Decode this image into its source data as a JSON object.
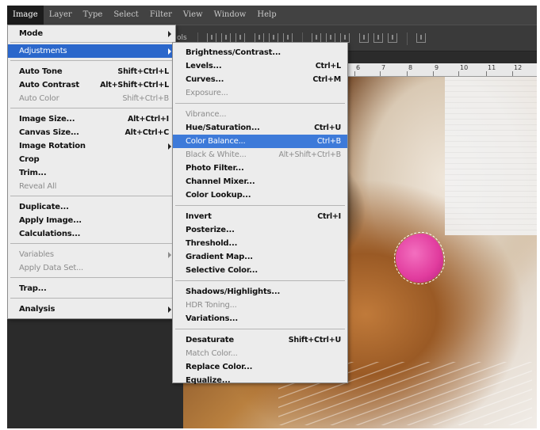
{
  "menubar": {
    "items": [
      "Image",
      "Layer",
      "Type",
      "Select",
      "Filter",
      "View",
      "Window",
      "Help"
    ]
  },
  "options_bar": {
    "label": "ols"
  },
  "ruler": {
    "marks": [
      "6",
      "7",
      "8",
      "9",
      "10",
      "11",
      "12"
    ]
  },
  "image_menu": {
    "items": [
      {
        "label": "Mode",
        "shortcut": "",
        "submenu": true,
        "disabled": false
      },
      {
        "label": "Adjustments",
        "shortcut": "",
        "submenu": true,
        "disabled": false,
        "highlighted": true
      },
      {
        "label": "Auto Tone",
        "shortcut": "Shift+Ctrl+L",
        "disabled": false
      },
      {
        "label": "Auto Contrast",
        "shortcut": "Alt+Shift+Ctrl+L",
        "disabled": false
      },
      {
        "label": "Auto Color",
        "shortcut": "Shift+Ctrl+B",
        "disabled": true
      },
      {
        "label": "Image Size...",
        "shortcut": "Alt+Ctrl+I",
        "disabled": false
      },
      {
        "label": "Canvas Size...",
        "shortcut": "Alt+Ctrl+C",
        "disabled": false
      },
      {
        "label": "Image Rotation",
        "shortcut": "",
        "submenu": true,
        "disabled": false
      },
      {
        "label": "Crop",
        "shortcut": "",
        "disabled": false
      },
      {
        "label": "Trim...",
        "shortcut": "",
        "disabled": false
      },
      {
        "label": "Reveal All",
        "shortcut": "",
        "disabled": true
      },
      {
        "label": "Duplicate...",
        "shortcut": "",
        "disabled": false
      },
      {
        "label": "Apply Image...",
        "shortcut": "",
        "disabled": false
      },
      {
        "label": "Calculations...",
        "shortcut": "",
        "disabled": false
      },
      {
        "label": "Variables",
        "shortcut": "",
        "submenu": true,
        "disabled": true
      },
      {
        "label": "Apply Data Set...",
        "shortcut": "",
        "disabled": true
      },
      {
        "label": "Trap...",
        "shortcut": "",
        "disabled": false
      },
      {
        "label": "Analysis",
        "shortcut": "",
        "submenu": true,
        "disabled": false
      }
    ]
  },
  "adjustments_menu": {
    "items": [
      {
        "label": "Brightness/Contrast...",
        "shortcut": "",
        "disabled": false
      },
      {
        "label": "Levels...",
        "shortcut": "Ctrl+L",
        "disabled": false
      },
      {
        "label": "Curves...",
        "shortcut": "Ctrl+M",
        "disabled": false
      },
      {
        "label": "Exposure...",
        "shortcut": "",
        "disabled": true
      },
      {
        "label": "Vibrance...",
        "shortcut": "",
        "disabled": true
      },
      {
        "label": "Hue/Saturation...",
        "shortcut": "Ctrl+U",
        "disabled": false
      },
      {
        "label": "Color Balance...",
        "shortcut": "Ctrl+B",
        "disabled": false,
        "highlighted": true
      },
      {
        "label": "Black & White...",
        "shortcut": "Alt+Shift+Ctrl+B",
        "disabled": true
      },
      {
        "label": "Photo Filter...",
        "shortcut": "",
        "disabled": false
      },
      {
        "label": "Channel Mixer...",
        "shortcut": "",
        "disabled": false
      },
      {
        "label": "Color Lookup...",
        "shortcut": "",
        "disabled": false
      },
      {
        "label": "Invert",
        "shortcut": "Ctrl+I",
        "disabled": false
      },
      {
        "label": "Posterize...",
        "shortcut": "",
        "disabled": false
      },
      {
        "label": "Threshold...",
        "shortcut": "",
        "disabled": false
      },
      {
        "label": "Gradient Map...",
        "shortcut": "",
        "disabled": false
      },
      {
        "label": "Selective Color...",
        "shortcut": "",
        "disabled": false
      },
      {
        "label": "Shadows/Highlights...",
        "shortcut": "",
        "disabled": false
      },
      {
        "label": "HDR Toning...",
        "shortcut": "",
        "disabled": true
      },
      {
        "label": "Variations...",
        "shortcut": "",
        "disabled": false
      },
      {
        "label": "Desaturate",
        "shortcut": "Shift+Ctrl+U",
        "disabled": false
      },
      {
        "label": "Match Color...",
        "shortcut": "",
        "disabled": true
      },
      {
        "label": "Replace Color...",
        "shortcut": "",
        "disabled": false
      },
      {
        "label": "Equalize...",
        "shortcut": "",
        "disabled": false
      }
    ]
  },
  "colors": {
    "highlight": "#2b67cb",
    "selection": "#e13c9e",
    "menu_bg": "#ececec",
    "chrome": "#424242"
  }
}
